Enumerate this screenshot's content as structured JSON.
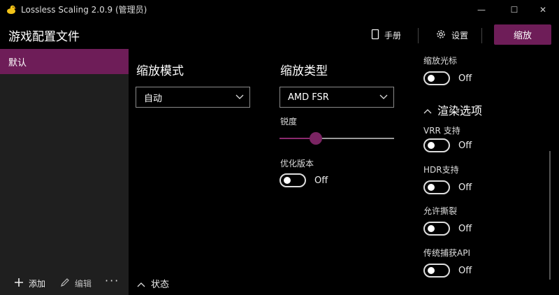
{
  "window": {
    "title": "Lossless Scaling 2.0.9 (管理员)",
    "minimize": "—",
    "maximize": "☐",
    "close": "✕"
  },
  "header": {
    "title": "游戏配置文件",
    "manual_label": "手册",
    "settings_label": "设置",
    "scale_button": "缩放"
  },
  "sidebar": {
    "items": [
      {
        "label": "默认",
        "selected": true
      }
    ],
    "add_label": "添加",
    "edit_label": "编辑",
    "more_label": "···"
  },
  "scaling_mode": {
    "title": "缩放模式",
    "value": "自动"
  },
  "scaling_type": {
    "title": "缩放类型",
    "value": "AMD FSR",
    "sharpness_label": "锐度",
    "sharpness_level": 0.32,
    "optimized_label": "优化版本",
    "optimized_state": "Off"
  },
  "right": {
    "scale_cursor_label": "缩放光标",
    "scale_cursor_state": "Off",
    "render_options_title": "渲染选项",
    "vrr_label": "VRR 支持",
    "vrr_state": "Off",
    "hdr_label": "HDR支持",
    "hdr_state": "Off",
    "tearing_label": "允许撕裂",
    "tearing_state": "Off",
    "legacy_capture_label": "传统捕获API",
    "legacy_capture_state": "Off"
  },
  "status": {
    "label": "状态"
  },
  "colors": {
    "accent": "#6e1d58",
    "sidebar": "#1f1f1f",
    "background": "#000000"
  }
}
